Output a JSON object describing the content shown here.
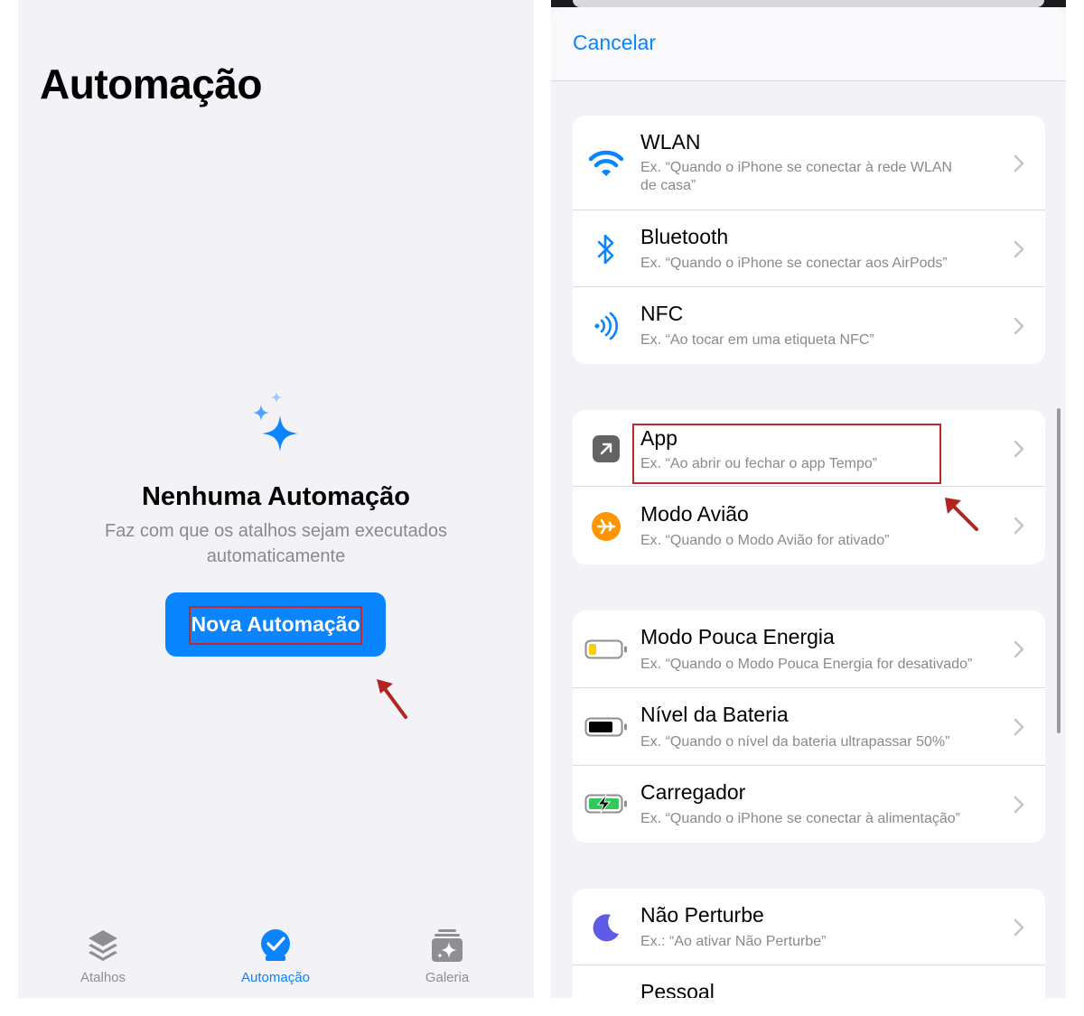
{
  "left": {
    "title": "Automação",
    "empty_state": {
      "title": "Nenhuma Automação",
      "subtitle_line1": "Faz com que os atalhos sejam executados",
      "subtitle_line2": "automaticamente",
      "button_label": "Nova Automação"
    },
    "tabs": [
      {
        "label": "Atalhos",
        "icon": "layers-icon",
        "active": false
      },
      {
        "label": "Automação",
        "icon": "clock-check-icon",
        "active": true
      },
      {
        "label": "Galeria",
        "icon": "gallery-sparkle-icon",
        "active": false
      }
    ],
    "accent_color": "#0a84ff",
    "highlight_color": "#c0282c"
  },
  "right": {
    "cancel_label": "Cancelar",
    "groups": [
      {
        "rows": [
          {
            "title": "WLAN",
            "subtitle_line1": "Ex. “Quando o iPhone se conectar à rede WLAN",
            "subtitle_line2": "de casa”",
            "icon": "wifi-icon"
          },
          {
            "title": "Bluetooth",
            "subtitle_line1": "Ex. “Quando o iPhone se conectar aos AirPods”",
            "icon": "bluetooth-icon"
          },
          {
            "title": "NFC",
            "subtitle_line1": "Ex. “Ao tocar em uma etiqueta NFC”",
            "icon": "nfc-icon"
          }
        ]
      },
      {
        "rows": [
          {
            "title": "App",
            "subtitle_line1": "Ex. “Ao abrir ou fechar o app Tempo”",
            "icon": "app-arrow-icon"
          },
          {
            "title": "Modo Avião",
            "subtitle_line1": "Ex. “Quando o Modo Avião for ativado”",
            "icon": "airplane-icon"
          }
        ]
      },
      {
        "rows": [
          {
            "title": "Modo Pouca Energia",
            "subtitle_line1": "Ex. “Quando o Modo Pouca Energia for desativado”",
            "icon": "battery-low-icon"
          },
          {
            "title": "Nível da Bateria",
            "subtitle_line1": "Ex. “Quando o nível da bateria ultrapassar 50%”",
            "icon": "battery-full-icon"
          },
          {
            "title": "Carregador",
            "subtitle_line1": "Ex. “Quando o iPhone se conectar à alimentação”",
            "icon": "battery-charging-icon"
          }
        ]
      },
      {
        "rows": [
          {
            "title": "Não Perturbe",
            "subtitle_line1": "Ex.: “Ao ativar Não Perturbe”",
            "icon": "moon-icon"
          },
          {
            "title": "Pessoal",
            "icon": "person-icon"
          }
        ]
      }
    ]
  }
}
